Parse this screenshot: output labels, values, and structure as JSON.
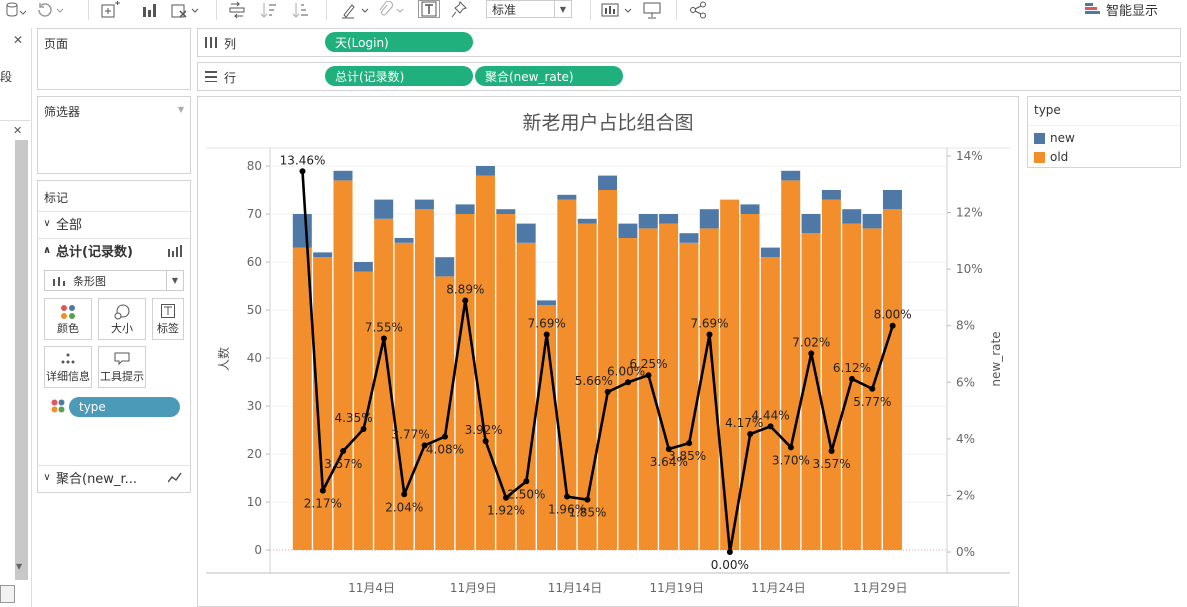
{
  "toolbar": {
    "style_value": "标准",
    "smart_show": "智能显示"
  },
  "left_rail": {
    "partial_text": "段",
    "close_glyph": "✕"
  },
  "pages_panel": {
    "title": "页面"
  },
  "filters_panel": {
    "title": "筛选器"
  },
  "marks_panel": {
    "title": "标记",
    "all_label": "全部",
    "measure_label": "总计(记录数)",
    "mark_type": "条形图",
    "buttons": {
      "color": "颜色",
      "size": "大小",
      "label": "标签",
      "detail": "详细信息",
      "tooltip": "工具提示"
    },
    "type_pill": "type",
    "second_measure": "聚合(new_r..."
  },
  "shelves": {
    "columns_label": "列",
    "rows_label": "行",
    "columns_pills": [
      "天(Login)"
    ],
    "rows_pills": [
      "总计(记录数)",
      "聚合(new_rate)"
    ]
  },
  "legend": {
    "title": "type",
    "items": [
      {
        "label": "new",
        "color": "#4e79a7"
      },
      {
        "label": "old",
        "color": "#f28e2b"
      }
    ]
  },
  "colors": {
    "new": "#4e79a7",
    "old": "#f28e2b",
    "line": "#000000",
    "pill": "#1fb07e",
    "type_pill": "#4b9bb8"
  },
  "chart_data": {
    "type": "bar",
    "title": "新老用户占比组合图",
    "ylabel": "人数",
    "y2label": "new_rate",
    "ylim": [
      0,
      80
    ],
    "y2lim": [
      0,
      14
    ],
    "y_ticks": [
      "0",
      "10",
      "20",
      "30",
      "40",
      "50",
      "60",
      "70",
      "80"
    ],
    "y2_ticks": [
      "0%",
      "2%",
      "4%",
      "6%",
      "8%",
      "10%",
      "12%",
      "14%"
    ],
    "x_tick_labels": [
      "11月4日",
      "11月9日",
      "11月14日",
      "11月19日",
      "11月24日",
      "11月29日"
    ],
    "x_tick_index": [
      3,
      8,
      13,
      18,
      23,
      28
    ],
    "categories": [
      "1",
      "2",
      "3",
      "4",
      "5",
      "6",
      "7",
      "8",
      "9",
      "10",
      "11",
      "12",
      "13",
      "14",
      "15",
      "16",
      "17",
      "18",
      "19",
      "20",
      "21",
      "22",
      "23",
      "24",
      "25",
      "26",
      "27",
      "28",
      "29",
      "30"
    ],
    "series": [
      {
        "name": "old",
        "values": [
          63,
          61,
          77,
          58,
          69,
          64,
          71,
          57,
          70,
          78,
          70,
          64,
          51,
          73,
          68,
          75,
          65,
          67,
          68,
          64,
          67,
          73,
          70,
          61,
          77,
          66,
          73,
          68,
          67,
          71
        ]
      },
      {
        "name": "new",
        "values": [
          7,
          1,
          2,
          2,
          4,
          1,
          2,
          4,
          2,
          2,
          1,
          4,
          1,
          1,
          1,
          3,
          3,
          3,
          2,
          2,
          4,
          0,
          2,
          2,
          2,
          4,
          2,
          3,
          3,
          4
        ]
      },
      {
        "name": "new_rate",
        "values": [
          13.46,
          2.17,
          3.57,
          4.35,
          7.55,
          2.04,
          3.77,
          4.08,
          8.89,
          3.92,
          1.92,
          2.5,
          7.69,
          1.96,
          1.85,
          5.66,
          6.0,
          6.25,
          3.64,
          3.85,
          7.69,
          0.0,
          4.17,
          4.44,
          3.7,
          7.02,
          3.57,
          6.12,
          5.77,
          8.0
        ]
      }
    ],
    "rate_labels": [
      "13.46%",
      "2.17%",
      "3.57%",
      "4.35%",
      "7.55%",
      "2.04%",
      "3.77%",
      "4.08%",
      "8.89%",
      "3.92%",
      "1.92%",
      "2.50%",
      "7.69%",
      "1.96%",
      "1.85%",
      "5.66%",
      "6.00%",
      "6.25%",
      "3.64%",
      "3.85%",
      "7.69%",
      "0.00%",
      "4.17%",
      "4.44%",
      "3.70%",
      "7.02%",
      "3.57%",
      "6.12%",
      "5.77%",
      "8.00%"
    ]
  }
}
